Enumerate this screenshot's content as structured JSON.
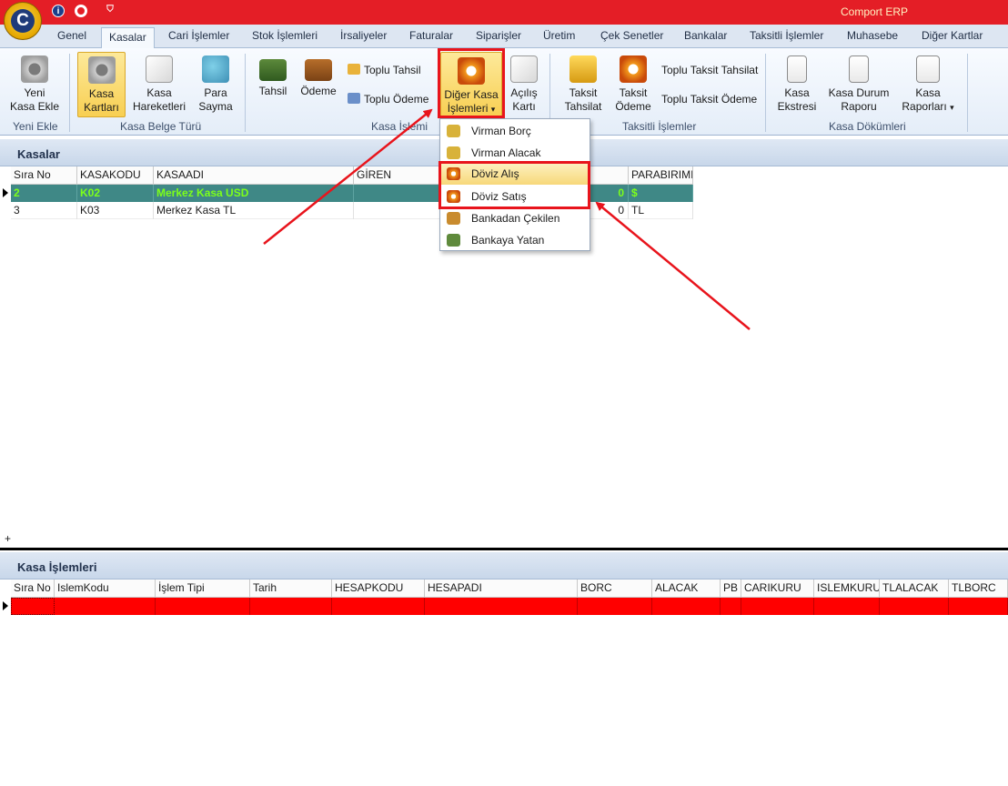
{
  "app": {
    "title": "Comport ERP",
    "orb_letter": "C",
    "info_glyph": "i",
    "custom_glyph": "⛉"
  },
  "tabs": [
    "Genel",
    "Kasalar",
    "Cari İşlemler",
    "Stok İşlemleri",
    "İrsaliyeler",
    "Faturalar",
    "Siparişler",
    "Üretim",
    "Çek Senetler",
    "Bankalar",
    "Taksitli İşlemler",
    "Muhasebe",
    "Diğer Kartlar"
  ],
  "ribbon": {
    "yeni_kasa_ekle": "Yeni\nKasa Ekle",
    "group_yeni_ekle": "Yeni Ekle",
    "kasa_kartlari": "Kasa\nKartları",
    "kasa_hareketleri": "Kasa\nHareketleri",
    "para_sayma": "Para\nSayma",
    "group_belge_turu": "Kasa Belge Türü",
    "tahsil": "Tahsil",
    "odeme": "Ödeme",
    "toplu_tahsil": "Toplu Tahsil",
    "toplu_odeme": "Toplu Ödeme",
    "diger_kasa_islemleri": "Diğer Kasa\nİşlemleri",
    "dropdown_caret": "▾",
    "acilis_karti": "Açılış\nKartı",
    "group_kasa_islemi": "Kasa İşlemi",
    "taksit_tahsilat": "Taksit\nTahsilat",
    "taksit_odeme": "Taksit\nÖdeme",
    "toplu_taksit_tahsilat": "Toplu Taksit Tahsilat",
    "toplu_taksit_odeme": "Toplu Taksit Ödeme",
    "group_taksitli": "Taksitli İşlemler",
    "kasa_ekstresi": "Kasa\nEkstresi",
    "kasa_durum_raporu": "Kasa Durum\nRaporu",
    "kasa_raporlari": "Kasa\nRaporları",
    "group_dokumleri": "Kasa Dökümleri"
  },
  "kasalar": {
    "title": "Kasalar",
    "columns": [
      "Sıra No",
      "KASAKODU",
      "KASAADI",
      "GİREN",
      "PARABIRIMI"
    ],
    "rows": [
      {
        "sira": "2",
        "kod": "K02",
        "ad": "Merkez Kasa USD",
        "bakiye": "0",
        "pb": "$"
      },
      {
        "sira": "3",
        "kod": "K03",
        "ad": "Merkez Kasa TL",
        "bakiye": "0",
        "pb": "TL"
      }
    ],
    "new_row_glyph": "+"
  },
  "menu": {
    "items": [
      "Virman Borç",
      "Virman Alacak",
      "Döviz Alış",
      "Döviz Satış",
      "Bankadan Çekilen",
      "Bankaya Yatan"
    ]
  },
  "kasa_islemleri": {
    "title": "Kasa İşlemleri",
    "columns": [
      "Sıra No",
      "IslemKodu",
      "İşlem Tipi",
      "Tarih",
      "HESAPKODU",
      "HESAPADI",
      "BORC",
      "ALACAK",
      "PB",
      "CARIKURU",
      "ISLEMKURU",
      "TLALACAK",
      "TLBORC"
    ]
  },
  "colors": {
    "title_bar": "#e41e26",
    "selected_row": "#3f8886",
    "selected_text": "#7dff1a",
    "annotation": "#e8141c",
    "new_row": "#ff0000"
  }
}
